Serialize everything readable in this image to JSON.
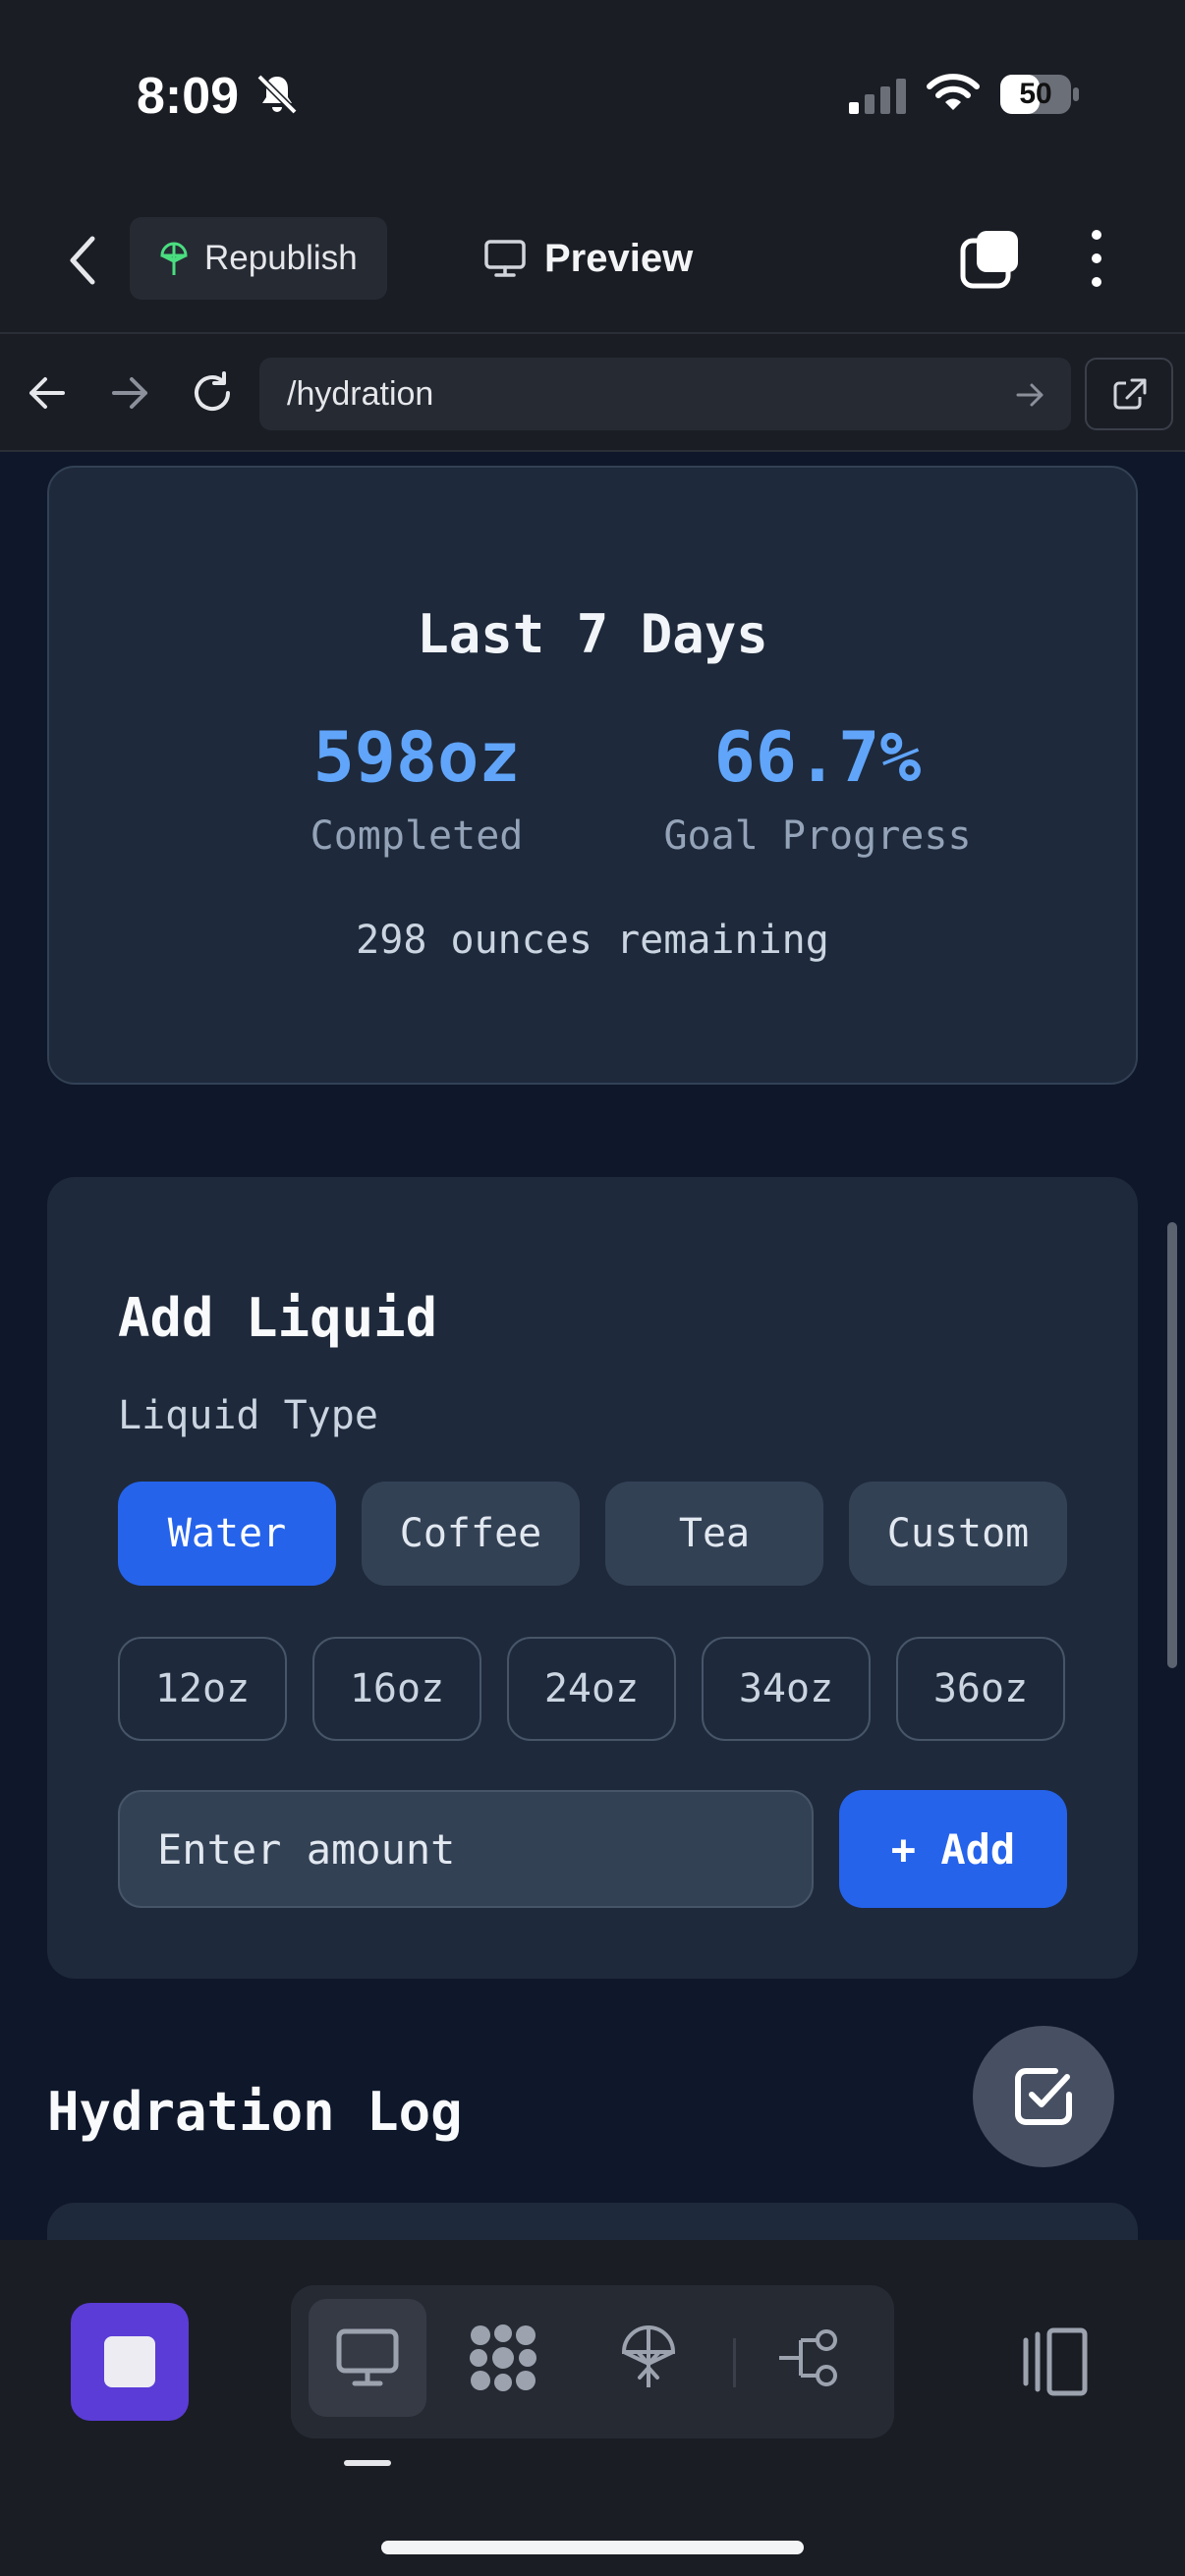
{
  "status_bar": {
    "time": "8:09",
    "battery": "50"
  },
  "toolbar": {
    "republish_label": "Republish",
    "preview_label": "Preview"
  },
  "browser": {
    "url": "/hydration"
  },
  "stats": {
    "title": "Last 7 Days",
    "completed_value": "598oz",
    "completed_label": "Completed",
    "progress_value": "66.7%",
    "progress_label": "Goal Progress",
    "remaining": "298 ounces remaining"
  },
  "add_liquid": {
    "title": "Add Liquid",
    "type_label": "Liquid Type",
    "types": [
      "Water",
      "Coffee",
      "Tea",
      "Custom"
    ],
    "selected_type": "Water",
    "sizes": [
      "12oz",
      "16oz",
      "24oz",
      "34oz",
      "36oz"
    ],
    "amount_placeholder": "Enter amount",
    "add_label": "+ Add"
  },
  "log": {
    "title": "Hydration Log"
  },
  "colors": {
    "accent": "#2563eb",
    "stat_value": "#60a5fa",
    "card": "#1e293b",
    "background": "#0f172a",
    "stop_button": "#5b3cd6"
  },
  "icons": {
    "status": [
      "bell-slash-icon",
      "cellular-signal-icon",
      "wifi-icon",
      "battery-icon"
    ],
    "toolbar": [
      "back-chevron-icon",
      "republish-icon",
      "monitor-icon",
      "tabs-icon",
      "kebab-menu-icon"
    ],
    "browser": [
      "back-arrow-icon",
      "forward-arrow-icon",
      "reload-icon",
      "go-arrow-icon",
      "open-external-icon"
    ],
    "dock": [
      "stop-icon",
      "monitor-icon",
      "workspace-dots-icon",
      "deploy-icon",
      "branch-icon",
      "side-panel-icon"
    ],
    "fab": "checkbox-icon"
  }
}
